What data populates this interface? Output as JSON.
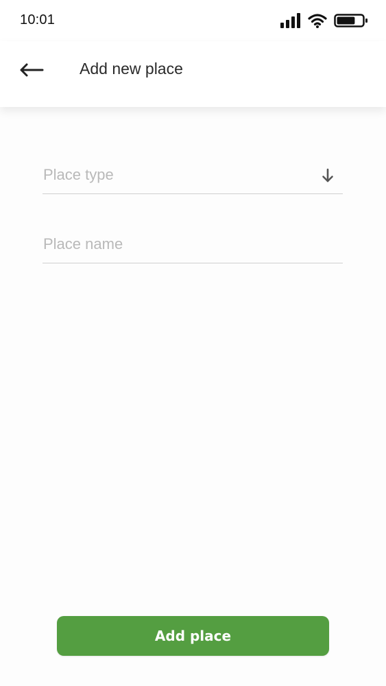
{
  "status_bar": {
    "time": "10:01",
    "icons": [
      "signal-icon",
      "wifi-icon",
      "battery-icon"
    ],
    "battery_level": 0.72
  },
  "app_bar": {
    "back_icon": "arrow-left-icon",
    "title": "Add new place"
  },
  "form": {
    "place_type": {
      "value": "",
      "placeholder": "Place type",
      "icon": "arrow-down-icon"
    },
    "place_name": {
      "value": "",
      "placeholder": "Place name"
    }
  },
  "actions": {
    "add_place_label": "Add place"
  },
  "colors": {
    "accent": "#549e41",
    "placeholder": "#b9b9b9",
    "underline": "#cfcfcf",
    "title": "#2a2a2a"
  }
}
